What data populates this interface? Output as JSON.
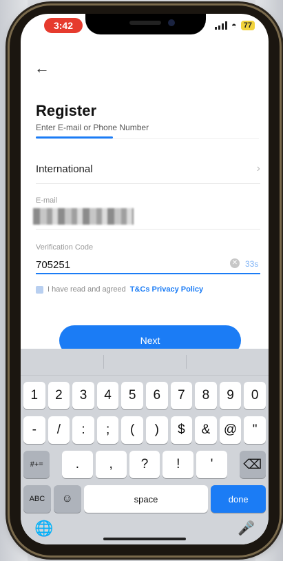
{
  "status": {
    "time": "3:42",
    "battery": "77"
  },
  "header": {
    "title": "Register",
    "subtitle": "Enter E-mail or Phone Number"
  },
  "region": {
    "label": "International"
  },
  "email": {
    "label": "E-mail"
  },
  "code": {
    "label": "Verification Code",
    "value": "705251",
    "countdown": "33s"
  },
  "agreement": {
    "text": "I have read and agreed",
    "link": "T&Cs Privacy Policy"
  },
  "next_button": "Next",
  "keyboard": {
    "row1": [
      "1",
      "2",
      "3",
      "4",
      "5",
      "6",
      "7",
      "8",
      "9",
      "0"
    ],
    "row2": [
      "-",
      "/",
      ":",
      ";",
      "(",
      ")",
      "$",
      "&",
      "@",
      "\""
    ],
    "row3_left": "#+=",
    "row3": [
      ".",
      ",",
      "?",
      "!",
      "'"
    ],
    "abc": "ABC",
    "space": "space",
    "done": "done"
  },
  "colors": {
    "accent": "#1b7cf5",
    "status_time_bg": "#e63b2e",
    "battery_bg": "#f2d33b"
  }
}
